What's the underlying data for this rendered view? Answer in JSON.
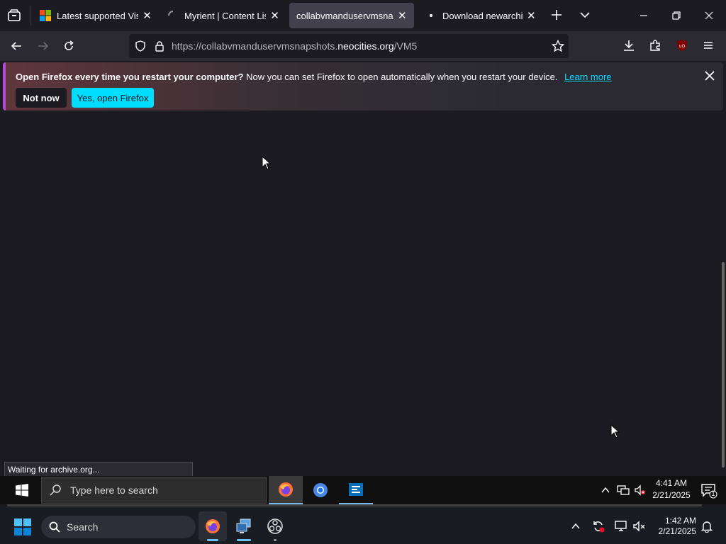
{
  "tabs": [
    {
      "label": "Latest supported Visual",
      "icon": "microsoft-logo-icon"
    },
    {
      "label": "Myrient | Content Listing",
      "icon": "loading-icon"
    },
    {
      "label": "collabvmanduservmsnapsh",
      "icon": "none",
      "active": true
    },
    {
      "label": "Download newarchive.",
      "icon": "dot-icon"
    }
  ],
  "navbar": {
    "url_prefix": "https://collabvmanduservmsnapshots.",
    "url_domain": "neocities.org",
    "url_suffix": "/VM5"
  },
  "notification": {
    "title": "Open Firefox every time you restart your computer?",
    "body": "Now you can set Firefox to open automatically when you restart your device.",
    "link": "Learn more",
    "not_now": "Not now",
    "yes": "Yes, open Firefox"
  },
  "status_text": "Waiting for archive.org...",
  "inner_taskbar": {
    "search_placeholder": "Type here to search",
    "time": "4:41 AM",
    "date": "2/21/2025",
    "notification_count": "1"
  },
  "outer_taskbar": {
    "search_label": "Search",
    "time": "1:42 AM",
    "date": "2/21/2025"
  },
  "colors": {
    "accent": "#00ddff",
    "background": "#1c1b22",
    "toolbar": "#2b2a33"
  }
}
